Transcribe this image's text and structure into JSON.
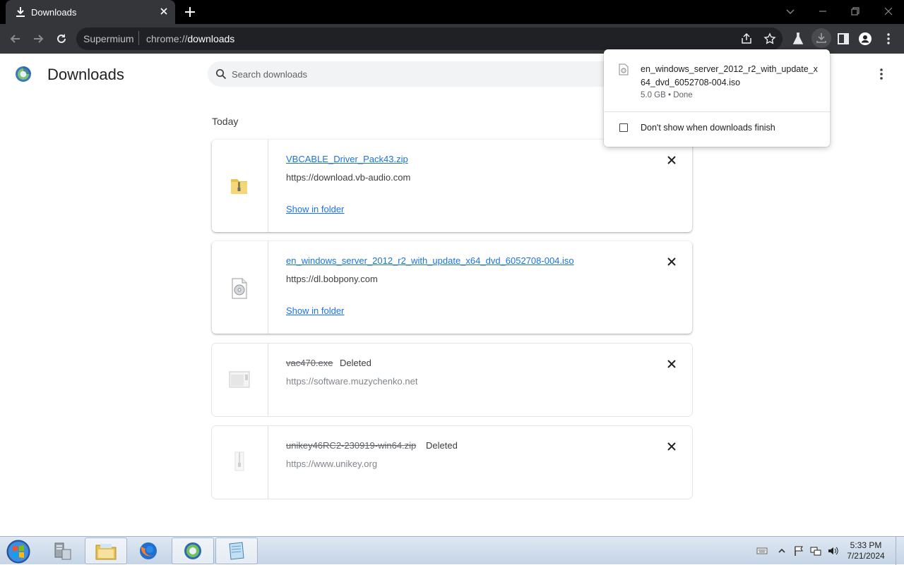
{
  "browser": {
    "tab": {
      "title": "Downloads"
    },
    "omnibox": {
      "site_name": "Supermium",
      "url_scheme": "chrome://",
      "url_host": "downloads"
    }
  },
  "page": {
    "title": "Downloads",
    "search_placeholder": "Search downloads",
    "section_date": "Today"
  },
  "downloads": [
    {
      "filename": "VBCABLE_Driver_Pack43.zip",
      "source": "https://download.vb-audio.com",
      "show_in_folder": "Show in folder",
      "status": "",
      "icon": "zip-folder-icon"
    },
    {
      "filename": "en_windows_server_2012_r2_with_update_x64_dvd_6052708-004.iso",
      "source": "https://dl.bobpony.com",
      "show_in_folder": "Show in folder",
      "status": "",
      "icon": "disc-image-icon"
    },
    {
      "filename": "vac470.exe",
      "source": "https://software.muzychenko.net",
      "status": "Deleted",
      "icon": "executable-icon"
    },
    {
      "filename": "unikey46RC2-230919-win64.zip",
      "source": "https://www.unikey.org",
      "status": "Deleted",
      "icon": "zip-icon"
    }
  ],
  "bubble": {
    "filename": "en_windows_server_2012_r2_with_update_x64_dvd_6052708-004.iso",
    "meta": "5.0 GB • Done",
    "checkbox_label": "Don't show when downloads finish",
    "checkbox_checked": false
  },
  "taskbar": {
    "apps": [
      "server-manager",
      "file-explorer",
      "firefox",
      "supermium",
      "notepad"
    ],
    "time": "5:33 PM",
    "date": "7/21/2024"
  },
  "colors": {
    "link": "#1a73e8",
    "chrome_dark": "#35363a",
    "tabstrip": "#000000"
  }
}
